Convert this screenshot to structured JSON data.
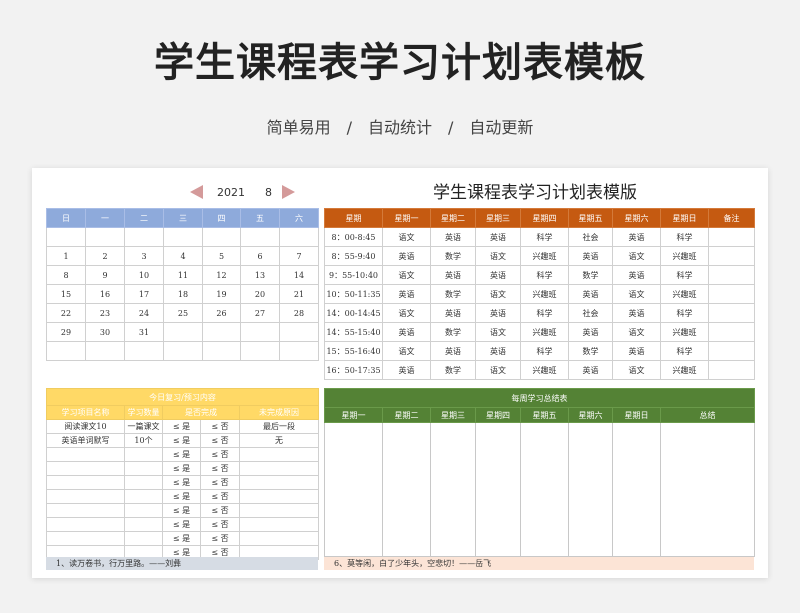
{
  "page": {
    "title": "学生课程表学习计划表模板",
    "subtitle": "简单易用　/　自动统计　/　自动更新"
  },
  "calendar": {
    "year": "2021",
    "month": "8",
    "weekdays": [
      "日",
      "一",
      "二",
      "三",
      "四",
      "五",
      "六"
    ],
    "weeks": [
      [
        "",
        "",
        "",
        "",
        "",
        "",
        ""
      ],
      [
        "1",
        "2",
        "3",
        "4",
        "5",
        "6",
        "7"
      ],
      [
        "8",
        "9",
        "10",
        "11",
        "12",
        "13",
        "14"
      ],
      [
        "15",
        "16",
        "17",
        "18",
        "19",
        "20",
        "21"
      ],
      [
        "22",
        "23",
        "24",
        "25",
        "26",
        "27",
        "28"
      ],
      [
        "29",
        "30",
        "31",
        "",
        "",
        "",
        ""
      ],
      [
        "",
        "",
        "",
        "",
        "",
        "",
        ""
      ]
    ]
  },
  "schedule": {
    "title": "学生课程表学习计划表模版",
    "headers": [
      "星期",
      "星期一",
      "星期二",
      "星期三",
      "星期四",
      "星期五",
      "星期六",
      "星期日",
      "备注"
    ],
    "rows": [
      [
        "8：00-8:45",
        "语文",
        "英语",
        "英语",
        "科学",
        "社会",
        "英语",
        "科学",
        ""
      ],
      [
        "8：55-9:40",
        "英语",
        "数学",
        "语文",
        "兴趣班",
        "英语",
        "语文",
        "兴趣班",
        ""
      ],
      [
        "9：55-10:40",
        "语文",
        "英语",
        "英语",
        "科学",
        "数学",
        "英语",
        "科学",
        ""
      ],
      [
        "10：50-11:35",
        "英语",
        "数学",
        "语文",
        "兴趣班",
        "英语",
        "语文",
        "兴趣班",
        ""
      ],
      [
        "14：00-14:45",
        "语文",
        "英语",
        "英语",
        "科学",
        "社会",
        "英语",
        "科学",
        ""
      ],
      [
        "14：55-15:40",
        "英语",
        "数学",
        "语文",
        "兴趣班",
        "英语",
        "语文",
        "兴趣班",
        ""
      ],
      [
        "15：55-16:40",
        "语文",
        "英语",
        "英语",
        "科学",
        "数学",
        "英语",
        "科学",
        ""
      ],
      [
        "16：50-17:35",
        "英语",
        "数学",
        "语文",
        "兴趣班",
        "英语",
        "语文",
        "兴趣班",
        ""
      ]
    ]
  },
  "study": {
    "title": "今日复习/预习内容",
    "headers": [
      "学习项目名称",
      "学习数量",
      "是否完成",
      "未完成原因"
    ],
    "rows": [
      [
        "阅读课文10",
        "一篇课文",
        "≤ 是",
        "≤ 否",
        "最后一段"
      ],
      [
        "英语单词默写",
        "10个",
        "≤ 是",
        "≤ 否",
        "无"
      ],
      [
        "",
        "",
        "≤ 是",
        "≤ 否",
        ""
      ],
      [
        "",
        "",
        "≤ 是",
        "≤ 否",
        ""
      ],
      [
        "",
        "",
        "≤ 是",
        "≤ 否",
        ""
      ],
      [
        "",
        "",
        "≤ 是",
        "≤ 否",
        ""
      ],
      [
        "",
        "",
        "≤ 是",
        "≤ 否",
        ""
      ],
      [
        "",
        "",
        "≤ 是",
        "≤ 否",
        ""
      ],
      [
        "",
        "",
        "≤ 是",
        "≤ 否",
        ""
      ],
      [
        "",
        "",
        "≤ 是",
        "≤ 否",
        ""
      ]
    ],
    "quote": "1、读万卷书，行万里路。——刘彝"
  },
  "summary": {
    "title": "每周学习总结表",
    "headers": [
      "星期一",
      "星期二",
      "星期三",
      "星期四",
      "星期五",
      "星期六",
      "星期日",
      "总结"
    ],
    "quote": "6、莫等闲，白了少年头，空悲切！——岳飞"
  },
  "colors": {
    "calendar_header": "#8eaadb",
    "schedule_header": "#c55a11",
    "study_header": "#ffd966",
    "summary_header": "#548235",
    "nav_arrow": "#d49a9a",
    "study_quote_bg": "#d6dce4",
    "summary_quote_bg": "#fce4d6"
  },
  "icons": {
    "prev": "triangle-left-icon",
    "next": "triangle-right-icon"
  }
}
